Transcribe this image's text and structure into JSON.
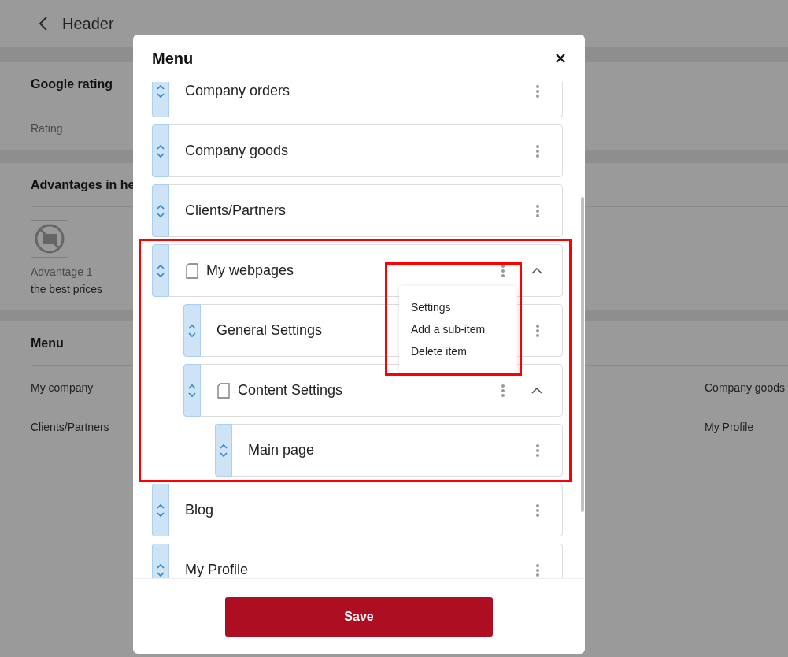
{
  "page": {
    "title": "Header",
    "google_rating": {
      "title": "Google rating",
      "label": "Rating"
    },
    "advantages": {
      "title": "Advantages in he",
      "items": [
        {
          "label": "Advantage 1",
          "text": "the best prices"
        }
      ]
    },
    "menu": {
      "title": "Menu",
      "links": [
        "My company",
        "Company goods",
        "Clients/Partners",
        "My Profile"
      ]
    }
  },
  "dialog": {
    "title": "Menu",
    "items": [
      {
        "label": "Company orders",
        "kind": "link"
      },
      {
        "label": "Company goods",
        "kind": "link"
      },
      {
        "label": "Clients/Partners",
        "kind": "link"
      },
      {
        "label": "My webpages",
        "kind": "page",
        "expanded": true,
        "highlighted": true,
        "context_menu": {
          "highlighted": true,
          "items": [
            "Settings",
            "Add a sub-item",
            "Delete item"
          ]
        },
        "children": [
          {
            "label": "General Settings",
            "kind": "link"
          },
          {
            "label": "Content Settings",
            "kind": "page",
            "expanded": true,
            "children": [
              {
                "label": "Main page",
                "kind": "link"
              }
            ]
          }
        ]
      },
      {
        "label": "Blog",
        "kind": "link"
      },
      {
        "label": "My Profile",
        "kind": "link"
      }
    ],
    "save_label": "Save"
  }
}
